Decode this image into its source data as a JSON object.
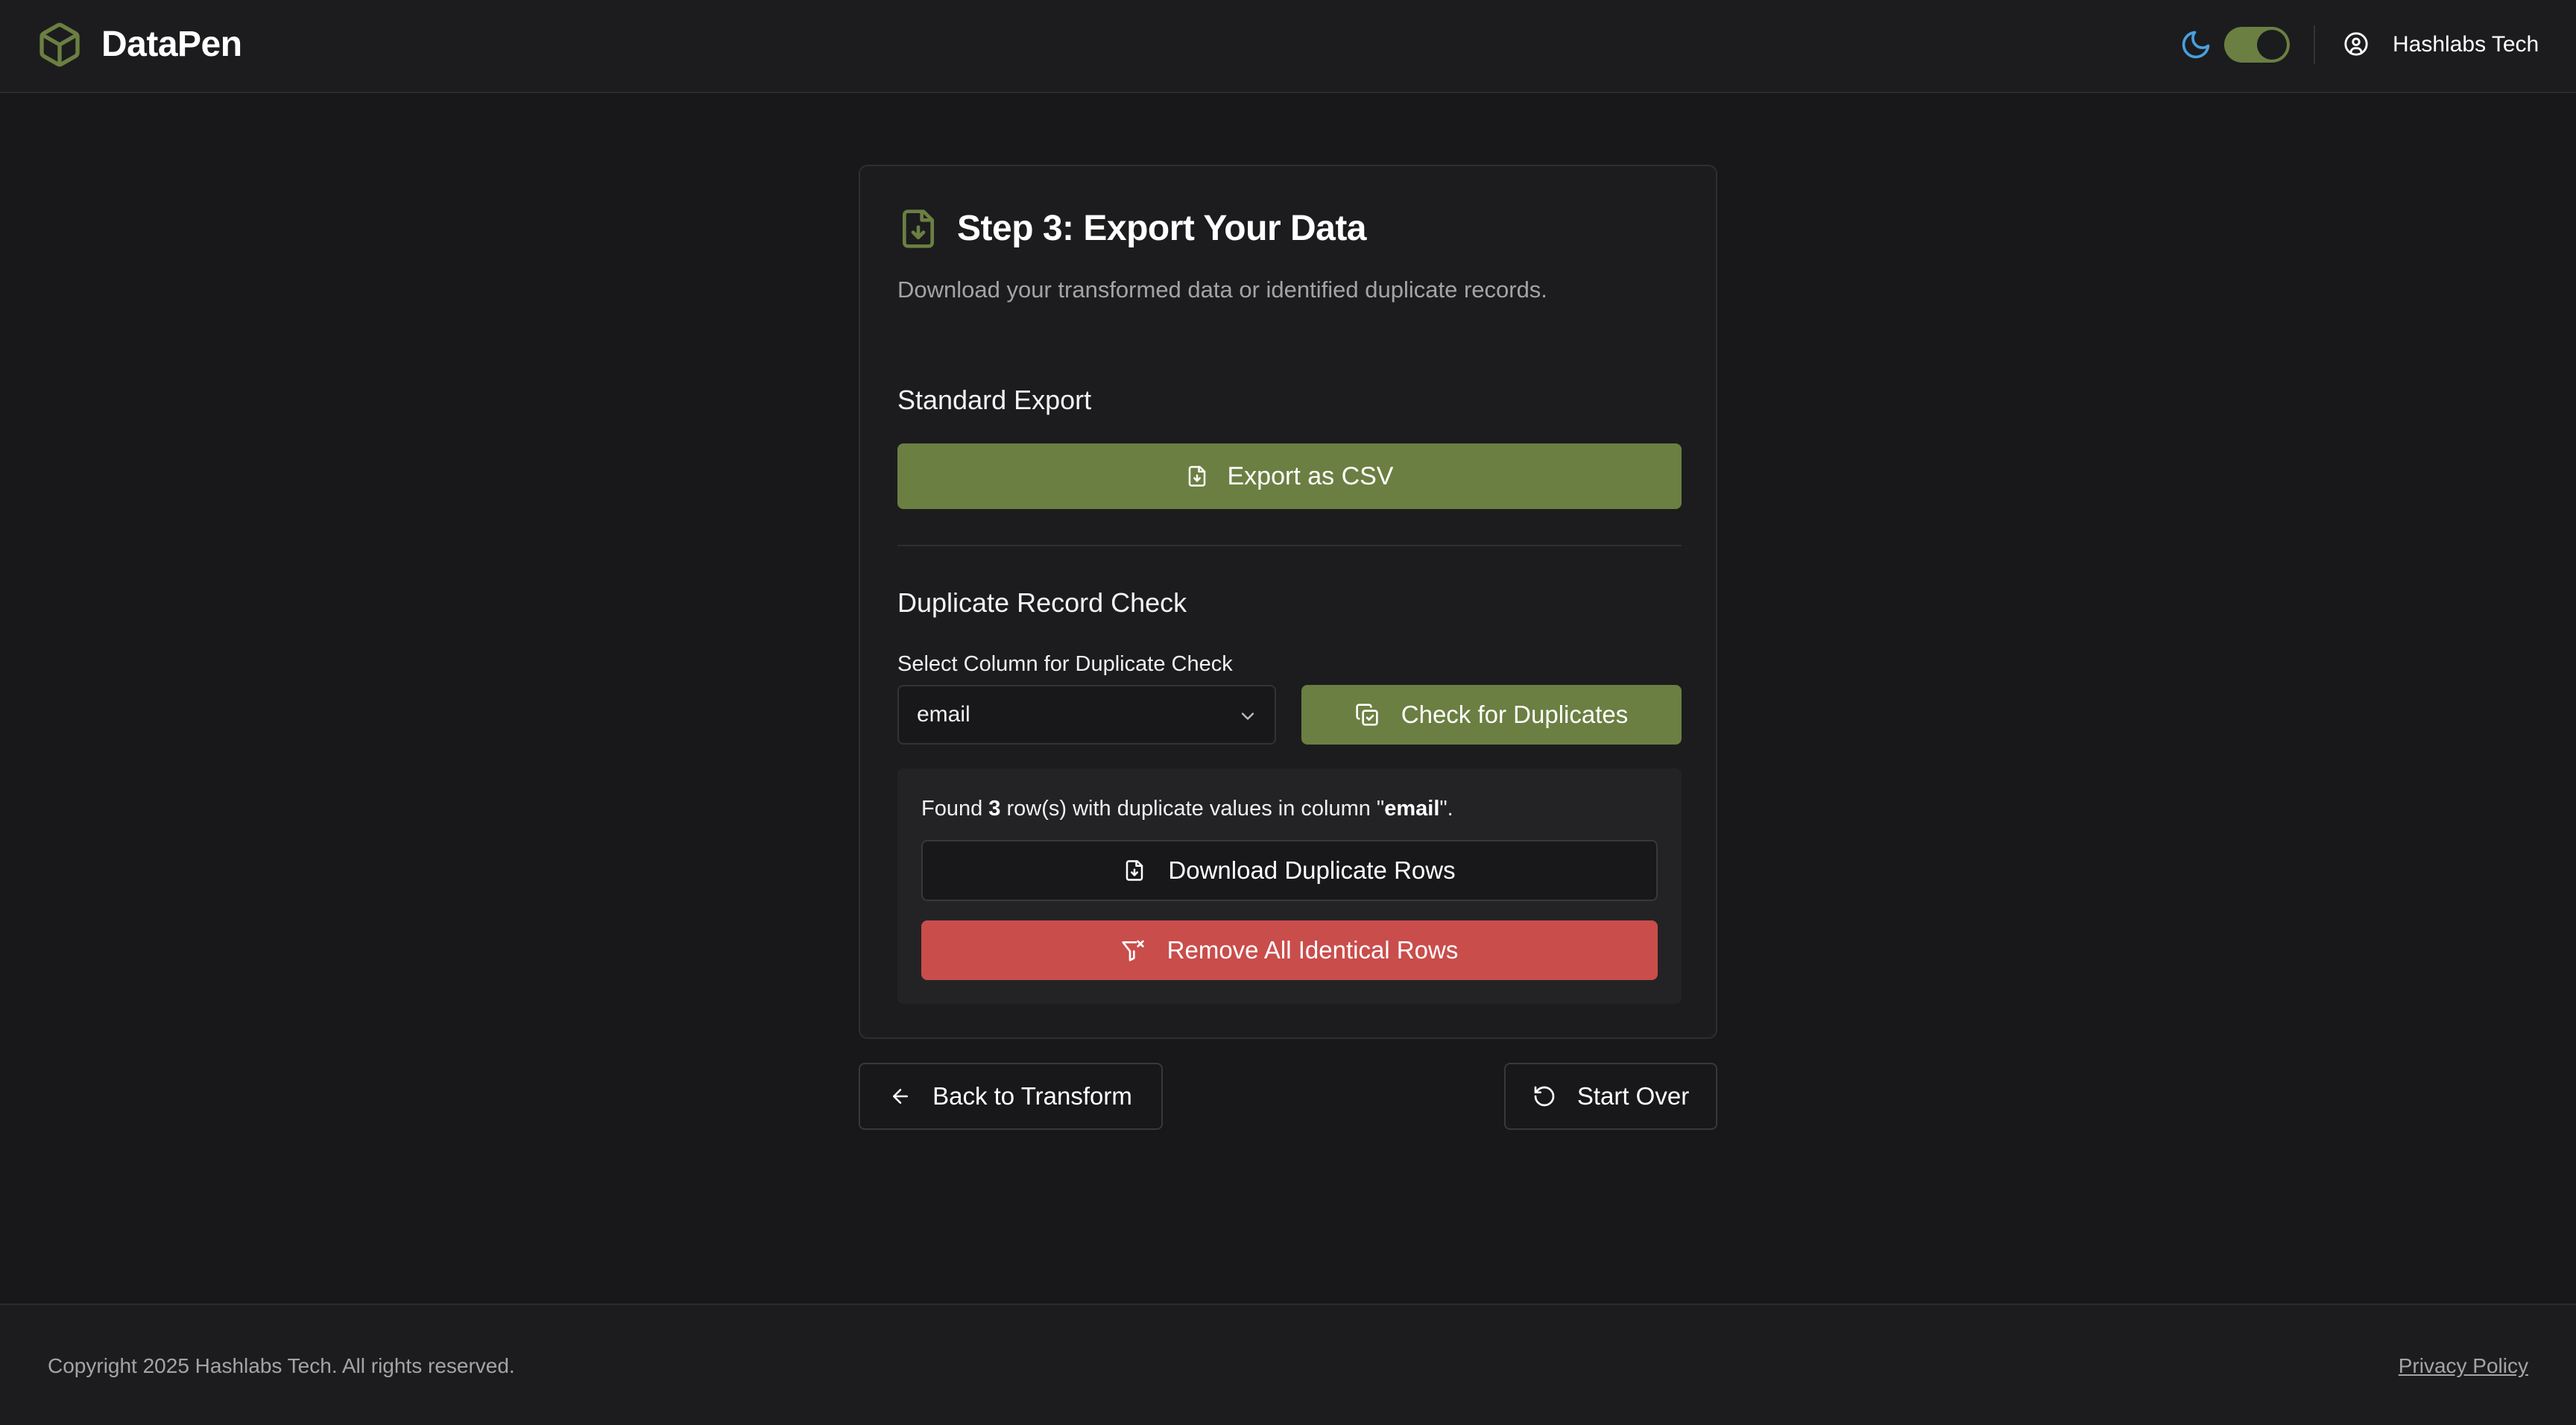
{
  "header": {
    "brand": "DataPen",
    "user_name": "Hashlabs Tech",
    "theme_toggle": "on",
    "accent_color": "#6b7f42"
  },
  "card": {
    "title": "Step 3: Export Your Data",
    "description": "Download your transformed data or identified duplicate records.",
    "standard_export": {
      "title": "Standard Export",
      "button_label": "Export as CSV"
    },
    "duplicate_check": {
      "title": "Duplicate Record Check",
      "field_label": "Select Column for Duplicate Check",
      "selected_column": "email",
      "check_button_label": "Check for Duplicates",
      "result": {
        "prefix": "Found ",
        "count": "3",
        "middle": " row(s) with duplicate values in column \"",
        "column": "email",
        "suffix": "\"."
      },
      "download_button_label": "Download Duplicate Rows",
      "remove_button_label": "Remove All Identical Rows",
      "remove_color": "#c94d4b"
    }
  },
  "navigation": {
    "back_label": "Back to Transform",
    "restart_label": "Start Over"
  },
  "footer": {
    "copyright": "Copyright 2025 Hashlabs Tech. All rights reserved.",
    "privacy_link": "Privacy Policy"
  },
  "icons": {
    "logo": "cube-icon",
    "theme": "moon-icon",
    "user": "user-circle-icon",
    "step": "file-download-icon",
    "select": "chevron-down-icon",
    "check": "copy-check-icon",
    "remove": "filter-x-icon",
    "back": "arrow-left-icon",
    "restart": "rotate-ccw-icon"
  }
}
